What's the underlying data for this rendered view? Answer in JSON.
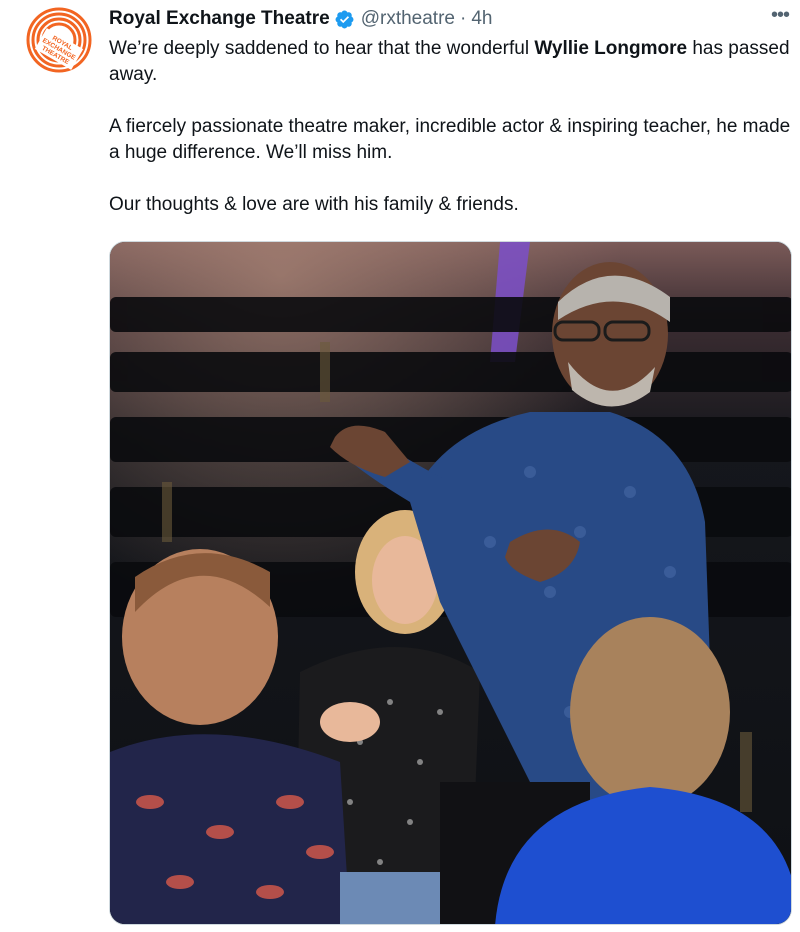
{
  "tweet": {
    "author_name": "Royal Exchange Theatre",
    "handle": "@rxtheatre",
    "separator": "·",
    "time": "4h",
    "more_label": "•••",
    "verified_icon": "verified-badge-icon",
    "avatar": {
      "logo_lines": [
        "ROYAL",
        "EXCHANGE",
        "THEATRE"
      ],
      "ring_color": "#f26522"
    },
    "text": {
      "p1_prefix": "We’re deeply saddened to hear that the wonderful ",
      "p1_bold": "Wyllie Longmore",
      "p1_suffix": " has passed away.",
      "p2": "A fiercely passionate theatre maker, incredible actor & inspiring teacher, he made a huge difference. We’ll miss him.",
      "p3": "Our thoughts & love are with his family & friends."
    },
    "photo": {
      "description_icon": "photo-of-man-speaking-to-seated-group"
    }
  },
  "colors": {
    "text": "#0f1419",
    "secondary": "#536471",
    "verified": "#1d9bf0",
    "brand_orange": "#f26522"
  }
}
